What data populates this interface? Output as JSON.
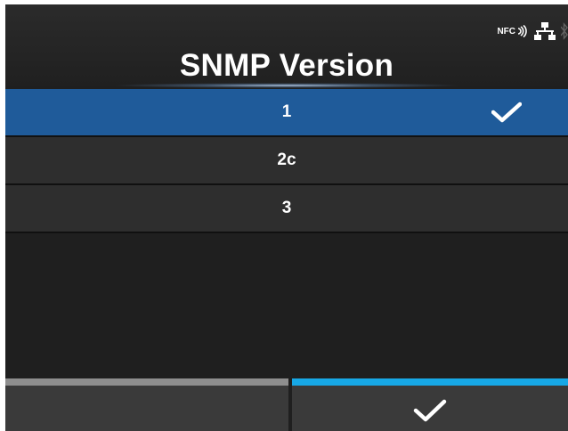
{
  "screen": {
    "title": "SNMP Version"
  },
  "status_bar": {
    "nfc_label": "NFC",
    "icons": [
      "nfc-icon",
      "network-icon",
      "bluetooth-icon"
    ]
  },
  "options": [
    {
      "label": "1",
      "selected": true
    },
    {
      "label": "2c",
      "selected": false
    },
    {
      "label": "3",
      "selected": false
    }
  ],
  "footer": {
    "left_button": {
      "label": ""
    },
    "right_button": {
      "icon": "check-icon"
    }
  },
  "colors": {
    "selected_row": "#1f5b9a",
    "confirm_accent": "#17a8e6",
    "cancel_accent": "#8e8e8e",
    "background": "#1f1f1f"
  }
}
